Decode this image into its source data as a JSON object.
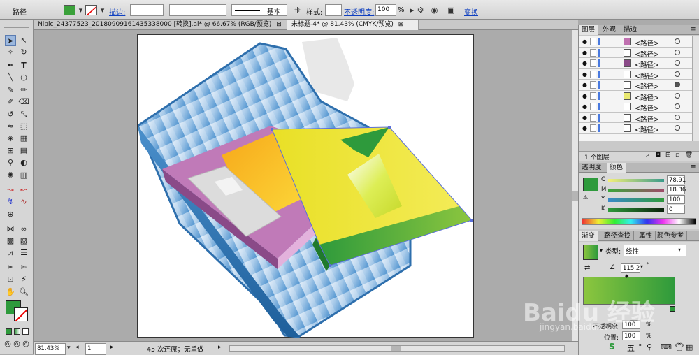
{
  "control_bar": {
    "object_type": "路径",
    "stroke_label": "描边:",
    "stroke_style": "基本",
    "style_label": "样式:",
    "opacity_label": "不透明度:",
    "opacity_value": "100",
    "opacity_unit": "%",
    "transform_label": "变换",
    "fill_color": "#3aa13a"
  },
  "tabs": [
    {
      "label": "Nipic_24377523_20180909161435338000 [转换].ai* @ 66.67% (RGB/预览)",
      "close": "⊠",
      "active": false
    },
    {
      "label": "未标题-4* @ 81.43% (CMYK/预览)",
      "close": "⊠",
      "active": true
    }
  ],
  "status_bar": {
    "zoom": "81.43%",
    "page": "1",
    "history": "45 次还原；无重做"
  },
  "layers_panel": {
    "tabs": [
      "图层",
      "外观",
      "描边"
    ],
    "rows": [
      {
        "name": "<路径>",
        "thumb": "#c070b0"
      },
      {
        "name": "<路径>",
        "thumb": "#ffffff"
      },
      {
        "name": "<路径>",
        "thumb": "#8a4a88"
      },
      {
        "name": "<路径>",
        "thumb": "#ffffff"
      },
      {
        "name": "<路径>",
        "thumb": "#ffffff"
      },
      {
        "name": "<路径>",
        "thumb": "#e8e870"
      },
      {
        "name": "<路径>",
        "thumb": "#ffffff"
      },
      {
        "name": "<路径>",
        "thumb": "#ffffff"
      },
      {
        "name": "<路径>",
        "thumb": "#ffffff"
      }
    ],
    "footer": "1 个图层"
  },
  "color_panel": {
    "tabs": [
      "透明度",
      "颜色"
    ],
    "channels": [
      {
        "label": "C",
        "value": "78.91"
      },
      {
        "label": "M",
        "value": "18.36"
      },
      {
        "label": "Y",
        "value": "100"
      },
      {
        "label": "K",
        "value": "0"
      }
    ],
    "current_color": "#2e9a3c"
  },
  "gradient_panel": {
    "tabs": [
      "渐变",
      "路径查找",
      "属性",
      "颜色参考"
    ],
    "type_label": "类型:",
    "type_value": "线性",
    "angle_value": "115.2",
    "angle_unit": "°",
    "opacity_label": "不透明度:",
    "opacity_value": "100",
    "position_label": "位置:",
    "position_value": "100",
    "unit": "%"
  },
  "watermark": {
    "brand": "Baidu 经验",
    "url": "jingyan.baidu.com"
  }
}
